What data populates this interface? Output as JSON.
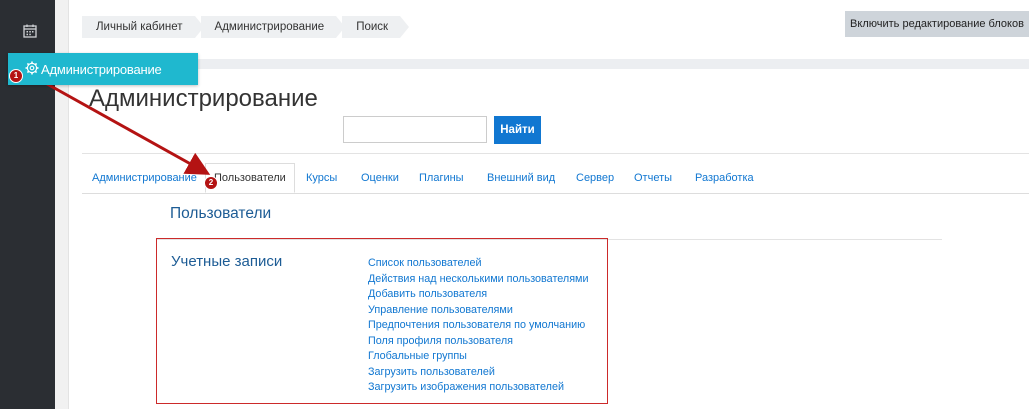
{
  "breadcrumb": [
    "Личный кабинет",
    "Администрирование",
    "Поиск"
  ],
  "edit_blocks_label": "Включить редактирование блоков",
  "sidebar": {
    "popup_label": "Администрирование"
  },
  "markers": {
    "first": "1",
    "second": "2"
  },
  "page_title": "Администрирование",
  "search": {
    "value": "",
    "button_label": "Найти"
  },
  "tabs": [
    {
      "label": "Администрирование",
      "active": false
    },
    {
      "label": "Пользователи",
      "active": true
    },
    {
      "label": "Курсы",
      "active": false
    },
    {
      "label": "Оценки",
      "active": false
    },
    {
      "label": "Плагины",
      "active": false
    },
    {
      "label": "Внешний вид",
      "active": false
    },
    {
      "label": "Сервер",
      "active": false
    },
    {
      "label": "Отчеты",
      "active": false
    },
    {
      "label": "Разработка",
      "active": false
    }
  ],
  "section_title": "Пользователи",
  "accounts": {
    "title": "Учетные записи",
    "links": [
      "Список пользователей",
      "Действия над несколькими пользователями",
      "Добавить пользователя",
      "Управление пользователями",
      "Предпочтения пользователя по умолчанию",
      "Поля профиля пользователя",
      "Глобальные группы",
      "Загрузить пользователей",
      "Загрузить изображения пользователей"
    ]
  },
  "icons": {
    "calendar": "calendar-icon",
    "gear": "gear-icon"
  },
  "colors": {
    "accent": "#1fb8cf",
    "link": "#1177d1",
    "annotation": "#b41313",
    "sidebar": "#2b2e33"
  }
}
